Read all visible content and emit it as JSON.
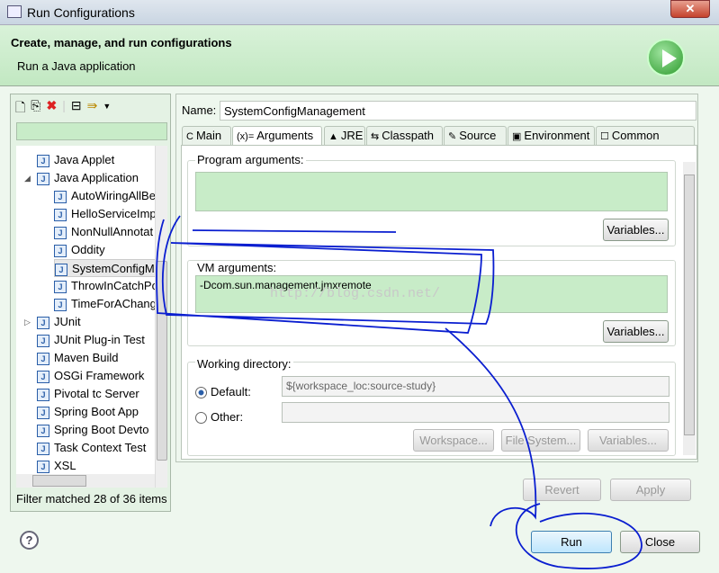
{
  "window": {
    "title": "Run Configurations"
  },
  "header": {
    "title": "Create, manage, and run configurations",
    "subtitle": "Run a Java application"
  },
  "tree": {
    "items": [
      {
        "label": "Java Applet",
        "icon": "java-applet-icon",
        "level": 0
      },
      {
        "label": "Java Application",
        "icon": "java-app-icon",
        "level": 0,
        "expanded": true
      },
      {
        "label": "AutoWiringAllBe",
        "icon": "java-class-icon",
        "level": 1
      },
      {
        "label": "HelloServiceImp",
        "icon": "java-class-icon",
        "level": 1
      },
      {
        "label": "NonNullAnnotat",
        "icon": "java-class-icon",
        "level": 1
      },
      {
        "label": "Oddity",
        "icon": "java-class-icon",
        "level": 1
      },
      {
        "label": "SystemConfigM",
        "icon": "java-class-icon",
        "level": 1,
        "selected": true
      },
      {
        "label": "ThrowInCatchPo",
        "icon": "java-class-icon",
        "level": 1
      },
      {
        "label": "TimeForAChang",
        "icon": "java-class-icon",
        "level": 1
      },
      {
        "label": "JUnit",
        "icon": "junit-icon",
        "level": 0,
        "collapsed": true
      },
      {
        "label": "JUnit Plug-in Test",
        "icon": "junit-plugin-icon",
        "level": 0
      },
      {
        "label": "Maven Build",
        "icon": "maven-icon",
        "level": 0
      },
      {
        "label": "OSGi Framework",
        "icon": "osgi-icon",
        "level": 0
      },
      {
        "label": "Pivotal tc Server",
        "icon": "pivotal-icon",
        "level": 0
      },
      {
        "label": "Spring Boot App",
        "icon": "spring-boot-icon",
        "level": 0
      },
      {
        "label": "Spring Boot Devto",
        "icon": "spring-devtools-icon",
        "level": 0
      },
      {
        "label": "Task Context Test",
        "icon": "task-context-icon",
        "level": 0
      },
      {
        "label": "XSL",
        "icon": "xsl-icon",
        "level": 0
      }
    ],
    "filter_status": "Filter matched 28 of 36 items",
    "filter_value": ""
  },
  "config": {
    "name_label": "Name:",
    "name_value": "SystemConfigManagement",
    "tabs": [
      {
        "label": "Main",
        "icon": "C"
      },
      {
        "label": "Arguments",
        "icon": "(x)="
      },
      {
        "label": "JRE",
        "icon": "▲"
      },
      {
        "label": "Classpath",
        "icon": "⇆"
      },
      {
        "label": "Source",
        "icon": "✎"
      },
      {
        "label": "Environment",
        "icon": "▣"
      },
      {
        "label": "Common",
        "icon": "☐"
      }
    ],
    "active_tab": "Arguments",
    "program_args_label": "Program arguments:",
    "program_args_value": "",
    "vm_args_label": "VM arguments:",
    "vm_args_value": "-Dcom.sun.management.jmxremote",
    "variables_label": "Variables...",
    "workdir_label": "Working directory:",
    "default_label": "Default:",
    "default_value": "${workspace_loc:source-study}",
    "other_label": "Other:",
    "other_value": "",
    "workspace_btn": "Workspace...",
    "filesystem_btn": "File System...",
    "variables_btn2": "Variables..."
  },
  "watermark": "http://blog.csdn.net/",
  "buttons": {
    "revert": "Revert",
    "apply": "Apply",
    "run": "Run",
    "close": "Close",
    "help": "?"
  },
  "colors": {
    "header_bg": "#c8ebc8",
    "annotation": "#0a1ed0"
  }
}
